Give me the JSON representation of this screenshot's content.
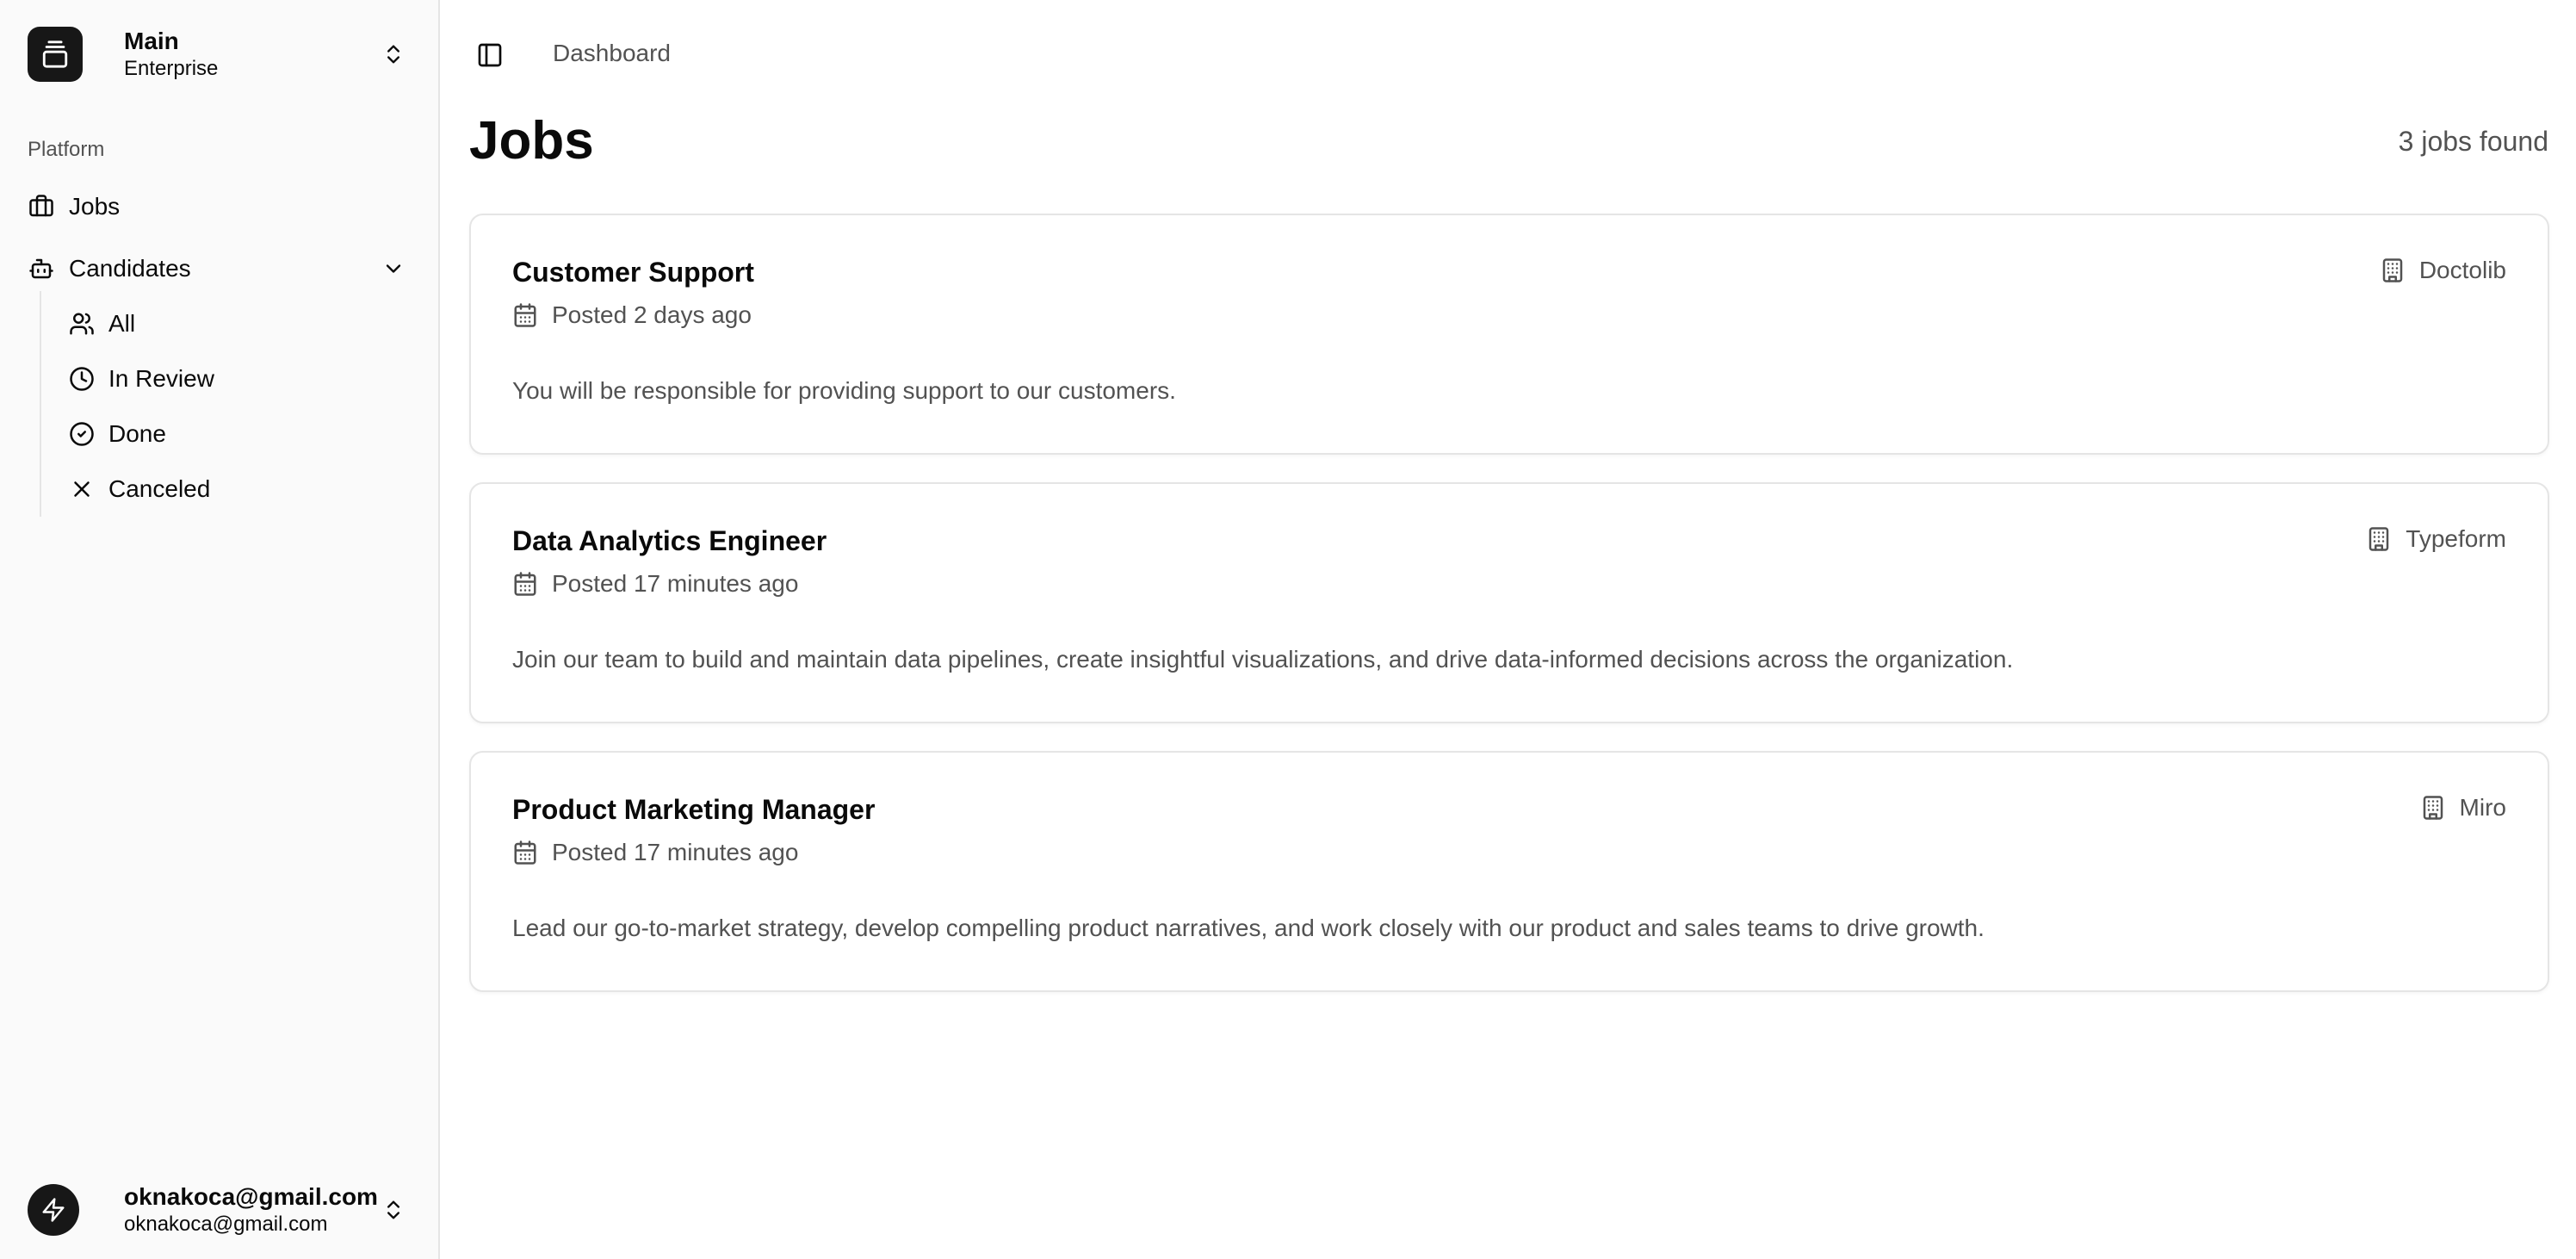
{
  "team": {
    "name": "Main",
    "plan": "Enterprise"
  },
  "sidebar": {
    "group_label": "Platform",
    "items": [
      {
        "label": "Jobs",
        "icon": "briefcase-icon"
      },
      {
        "label": "Candidates",
        "icon": "bot-icon",
        "expanded": true
      }
    ],
    "candidates_sub": [
      {
        "label": "All",
        "icon": "users-icon"
      },
      {
        "label": "In Review",
        "icon": "clock-icon"
      },
      {
        "label": "Done",
        "icon": "circle-check-icon"
      },
      {
        "label": "Canceled",
        "icon": "x-icon"
      }
    ]
  },
  "user": {
    "name": "oknakoca@gmail.com",
    "email": "oknakoca@gmail.com"
  },
  "header": {
    "breadcrumb": "Dashboard"
  },
  "main": {
    "title": "Jobs",
    "count_text": "3 jobs found",
    "jobs": [
      {
        "title": "Customer Support",
        "posted": "Posted 2 days ago",
        "company": "Doctolib",
        "description": "You will be responsible for providing support to our customers."
      },
      {
        "title": "Data Analytics Engineer",
        "posted": "Posted 17 minutes ago",
        "company": "Typeform",
        "description": "Join our team to build and maintain data pipelines, create insightful visualizations, and drive data-informed decisions across the organization."
      },
      {
        "title": "Product Marketing Manager",
        "posted": "Posted 17 minutes ago",
        "company": "Miro",
        "description": "Lead our go-to-market strategy, develop compelling product narratives, and work closely with our product and sales teams to drive growth."
      }
    ]
  },
  "colors": {
    "sidebar_bg": "#fafafa",
    "border": "#e5e5e5",
    "text": "#0a0a0a",
    "muted": "#525252",
    "accent_dark": "#171717"
  }
}
